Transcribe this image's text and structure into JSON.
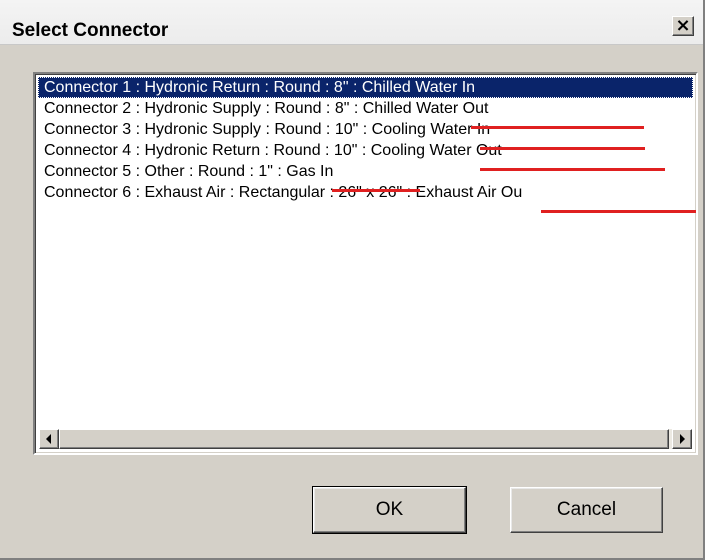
{
  "window": {
    "title": "Select Connector",
    "close_glyph": "×"
  },
  "list": {
    "items": [
      {
        "label": "Connector 1 : Hydronic Return : Round : 8\" : Chilled Water In",
        "selected": true
      },
      {
        "label": "Connector 2 : Hydronic Supply : Round : 8\" : Chilled Water Out",
        "selected": false
      },
      {
        "label": "Connector 3 : Hydronic Supply : Round : 10\" : Cooling Water In",
        "selected": false
      },
      {
        "label": "Connector 4 : Hydronic Return : Round : 10\" : Cooling Water Out",
        "selected": false
      },
      {
        "label": "Connector 5 : Other : Round : 1\" : Gas In",
        "selected": false
      },
      {
        "label": "Connector 6 : Exhaust Air : Rectangular : 26\" x 26\" : Exhaust Air Ou",
        "selected": false
      }
    ]
  },
  "buttons": {
    "ok": "OK",
    "cancel": "Cancel"
  },
  "colors": {
    "selection": "#0a246a",
    "annotation_underline": "#e02020",
    "dialog_face": "#d4d0c8"
  }
}
